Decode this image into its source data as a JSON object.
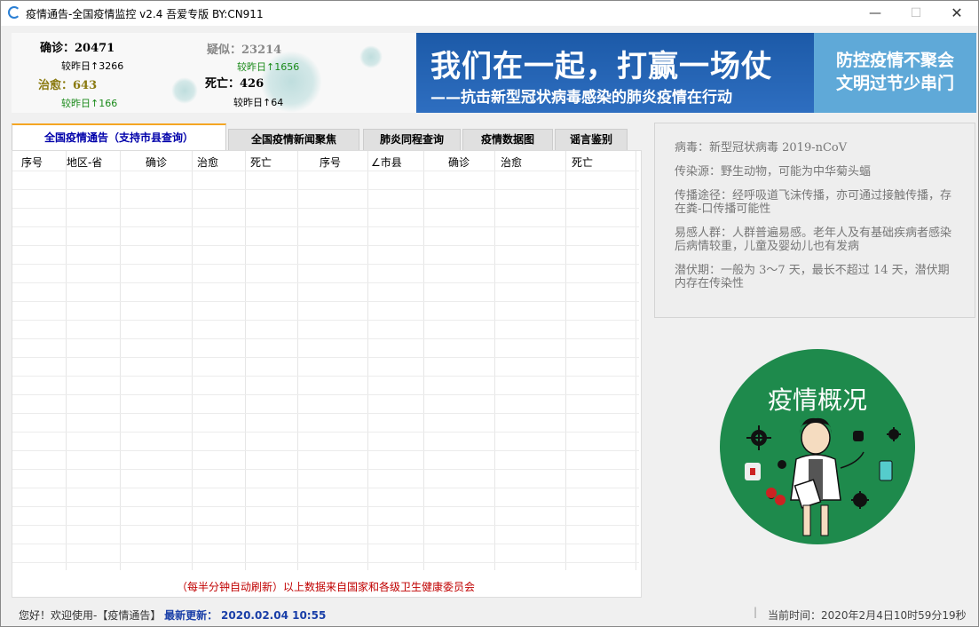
{
  "window": {
    "title": "疫情通告-全国疫情监控 v2.4   吾爱专版   BY:CN911",
    "controls": {
      "minimize": "—",
      "maximize": "☐",
      "close": "✕"
    }
  },
  "stats": {
    "confirmed": {
      "label": "确诊：20471",
      "change": "较昨日↑3266",
      "color": "#000000"
    },
    "suspected": {
      "label": "疑似：23214",
      "change": "较昨日↑1656",
      "color": "#888888"
    },
    "cured": {
      "label": "治愈：643",
      "change": "较昨日↑166",
      "color": "#8a7a10"
    },
    "dead": {
      "label": "死亡：426",
      "change": "较昨日↑64",
      "color": "#000000"
    },
    "change_green": "#1a8a1a"
  },
  "banner": {
    "main": "我们在一起，打赢一场仗",
    "sub": "——抗击新型冠状病毒感染的肺炎疫情在行动",
    "side_line1": "防控疫情不聚会",
    "side_line2": "文明过节少串门"
  },
  "tabs": [
    {
      "label": "全国疫情通告（支持市县查询）",
      "active": true
    },
    {
      "label": "全国疫情新闻聚焦",
      "active": false
    },
    {
      "label": "肺炎同程查询",
      "active": false
    },
    {
      "label": "疫情数据图",
      "active": false
    },
    {
      "label": "谣言鉴别",
      "active": false
    }
  ],
  "table": {
    "headers": [
      "序号",
      "地区-省",
      "确诊",
      "治愈",
      "死亡",
      "序号",
      "∠市县",
      "确诊",
      "治愈",
      "死亡"
    ],
    "rows": []
  },
  "footer_note": "（每半分钟自动刷新）以上数据来自国家和各级卫生健康委员会",
  "info": [
    "病毒：新型冠状病毒 2019-nCoV",
    "传染源：野生动物，可能为中华菊头蝠",
    "传播途径：经呼吸道飞沫传播，亦可通过接触传播，存在粪-口传播可能性",
    "易感人群：人群普遍易感。老年人及有基础疾病者感染后病情较重，儿童及婴幼儿也有发病",
    "潜伏期：一般为 3～7 天，最长不超过 14 天，潜伏期内存在传染性"
  ],
  "overview": {
    "title": "疫情概况"
  },
  "status": {
    "greeting": "您好！欢迎使用-【疫情通告】",
    "update_label": "最新更新：",
    "update_value": "2020.02.04 10:55",
    "separator": "|",
    "time_label": "当前时间：",
    "time_value": "2020年2月4日10时59分19秒"
  }
}
